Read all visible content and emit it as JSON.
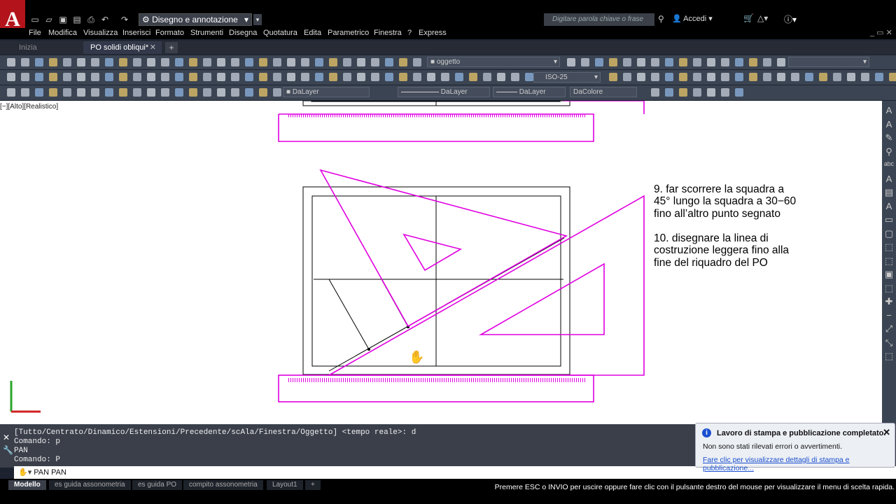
{
  "app": {
    "logo": "A",
    "workspace": "Disegno e annotazione",
    "search_placeholder": "Digitare parola chiave o frase",
    "login": "Accedi"
  },
  "menu": [
    "File",
    "Modifica",
    "Visualizza",
    "Inserisci",
    "Formato",
    "Strumenti",
    "Disegna",
    "Quotatura",
    "Edita",
    "Parametrico",
    "Finestra",
    "?",
    "Express"
  ],
  "file_tabs": [
    {
      "label": "Inizia"
    },
    {
      "label": "PO solidi obliqui*"
    }
  ],
  "toolbar": {
    "layer_current": "oggetto",
    "dimstyle": "ISO-25",
    "layer_props": [
      "DaLayer",
      "DaLayer",
      "DaLayer",
      "DaColore"
    ]
  },
  "viewport_label": "[−][Alto][Realistico]",
  "annotation": {
    "step9": [
      "9. far scorrere la squadra a",
      "45° lungo la squadra a 30−60",
      "fino all’altro punto segnato"
    ],
    "step10": [
      "10. disegnare la linea di",
      "costruzione leggera fino alla",
      "fine del riquadro del PO"
    ]
  },
  "command_history": [
    "[Tutto/Centrato/Dinamico/Estensioni/Precedente/scAla/Finestra/Oggetto] <tempo reale>: d",
    "Comando: p",
    "PAN",
    "Comando: P"
  ],
  "command_input": "PAN PAN",
  "notification": {
    "title": "Lavoro di stampa e pubblicazione completato.",
    "body": "Non sono stati rilevati errori o avvertimenti.",
    "link": "Fare clic per visualizzare dettagli di stampa e pubblicazione..."
  },
  "layout_tabs": [
    "Modello",
    "es guida assonometria",
    "es guida PO",
    "compito assonometria",
    "Layout1"
  ],
  "status_message": "Premere ESC o INVIO per uscire oppure fare clic con il pulsante destro del mouse per visualizzare il menu di scelta rapida.",
  "colors": {
    "drawing_magenta": "#e000e0",
    "accent": "#b3141b",
    "link": "#1a4fd0"
  },
  "icons": [
    "new-icon",
    "open-icon",
    "save-icon",
    "undo-icon",
    "redo-icon",
    "pan-hand-icon",
    "zoom-icon",
    "help-icon",
    "cart-icon",
    "close-icon",
    "info-icon",
    "wrench-icon",
    "ucs-icon"
  ]
}
